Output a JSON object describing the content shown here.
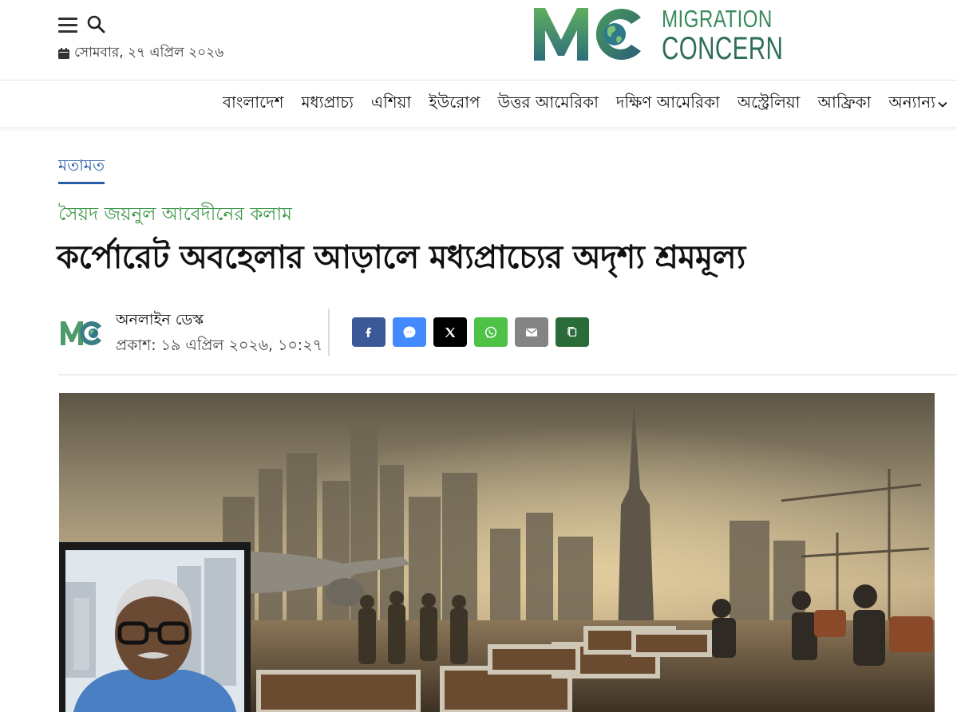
{
  "header": {
    "date": "সোমবার, ২৭ এপ্রিল ২০২৬",
    "logo": {
      "mark": "MC",
      "line1": "MIGRATION",
      "line2": "CONCERN"
    }
  },
  "nav": {
    "items": [
      "বাংলাদেশ",
      "মধ্যপ্রাচ্য",
      "এশিয়া",
      "ইউরোপ",
      "উত্তর আমেরিকা",
      "দক্ষিণ আমেরিকা",
      "অস্ট্রেলিয়া",
      "আফ্রিকা",
      "অন্যান্য"
    ]
  },
  "article": {
    "category": "মতামত",
    "column": "সৈয়দ জয়নুল আবেদীনের কলাম",
    "headline": "কর্পোরেট অবহেলার আড়ালে মধ্যপ্রাচ্যের অদৃশ্য শ্রমমূল্য",
    "author": "অনলাইন ডেস্ক",
    "published": "প্রকাশ: ১৯ এপ্রিল ২০২৬, ১০:২৭"
  },
  "share": [
    {
      "name": "facebook-icon",
      "color": "#3b5998"
    },
    {
      "name": "messenger-icon",
      "color": "#448aff"
    },
    {
      "name": "x-icon",
      "color": "#000000"
    },
    {
      "name": "whatsapp-icon",
      "color": "#4dc247"
    },
    {
      "name": "email-icon",
      "color": "#848484"
    },
    {
      "name": "copy-icon",
      "color": "#2a6b3a"
    }
  ],
  "colors": {
    "category": "#2a5ea8",
    "column": "#3f9a4a",
    "logo_green": "#3a8a5c"
  }
}
